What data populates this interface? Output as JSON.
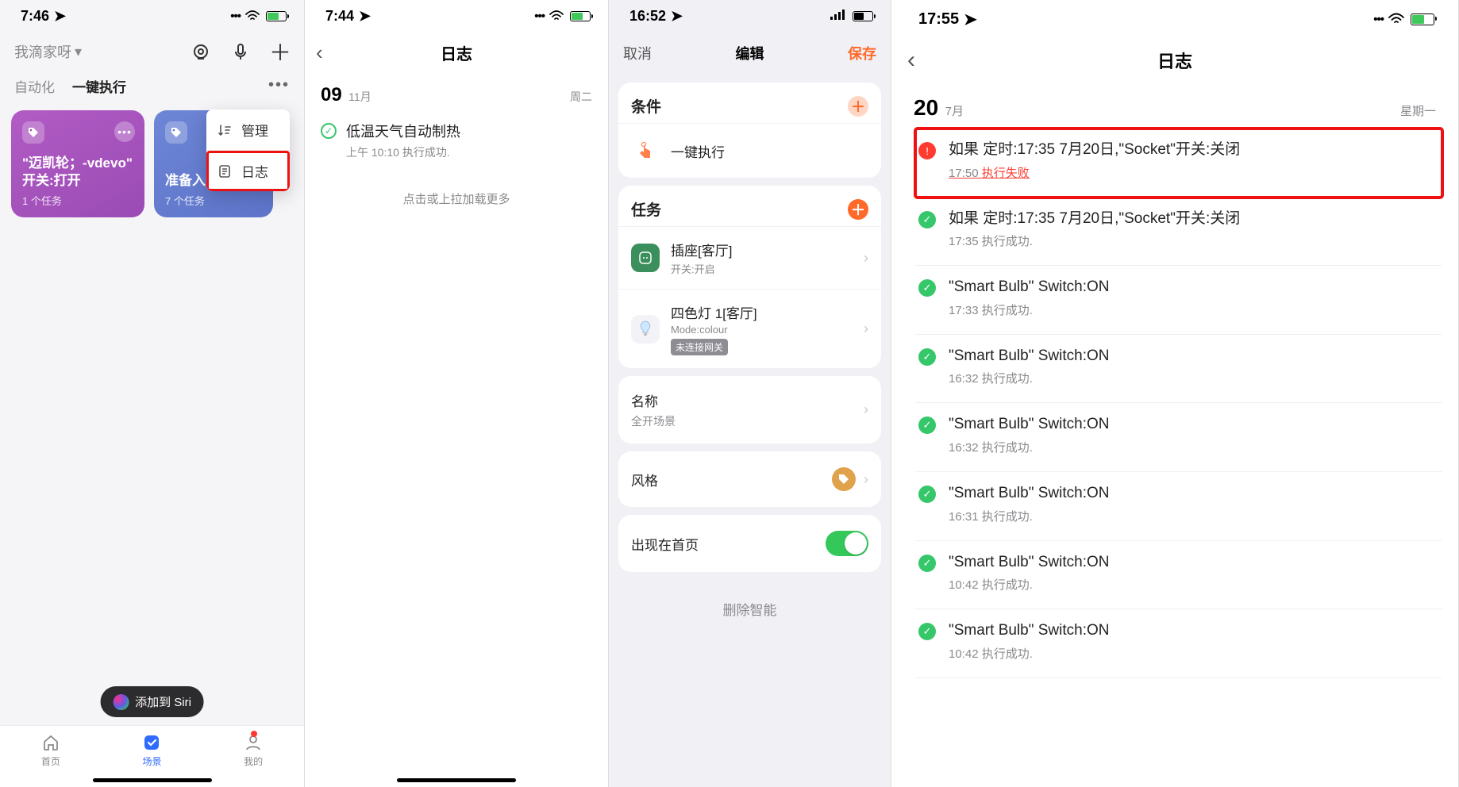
{
  "screen1": {
    "status": {
      "time": "7:46",
      "signal": "⠿",
      "wifi": "wifi",
      "batt_pct": 60
    },
    "home_select": "我滴家呀",
    "tabs": {
      "auto": "自动化",
      "scene": "一键执行"
    },
    "popover": {
      "manage": "管理",
      "log": "日志"
    },
    "cards": [
      {
        "title": "\"迈凯轮；-vdevo\"\n开关:打开",
        "sub": "1 个任务",
        "cls": "purple"
      },
      {
        "title": "准备入睡",
        "sub": "7 个任务",
        "cls": "blue"
      }
    ],
    "siri": "添加到 Siri",
    "tabbar": {
      "home": "首页",
      "scene": "场景",
      "me": "我的"
    }
  },
  "screen2": {
    "status": {
      "time": "7:44",
      "batt_pct": 60
    },
    "title": "日志",
    "date_day": "09",
    "date_month": "11月",
    "date_wd": "周二",
    "log_title": "低温天气自动制热",
    "log_sub": "上午 10:10 执行成功.",
    "hint": "点击或上拉加载更多"
  },
  "screen3": {
    "status": {
      "time": "16:52",
      "batt_pct": 50
    },
    "nav": {
      "cancel": "取消",
      "title": "编辑",
      "save": "保存"
    },
    "cond": {
      "header": "条件",
      "type": "一键执行"
    },
    "task": {
      "header": "任务",
      "items": [
        {
          "icon": "socket",
          "title": "插座[客厅]",
          "sub": "开关:开启"
        },
        {
          "icon": "bulb",
          "title": "四色灯 1[客厅]",
          "sub": "Mode:colour",
          "badge": "未连接网关"
        }
      ]
    },
    "name": {
      "label": "名称",
      "value": "全开场景"
    },
    "style": {
      "label": "风格"
    },
    "homepage": {
      "label": "出现在首页"
    },
    "delete": "删除智能"
  },
  "screen4": {
    "status": {
      "time": "17:55",
      "batt_pct": 55
    },
    "title": "日志",
    "date_day": "20",
    "date_month": "7月",
    "date_wd": "星期一",
    "rows": [
      {
        "status": "err",
        "title": "如果 定时:17:35 7月20日,\"Socket\"开关:关闭",
        "time": "17:50",
        "result": "执行失败",
        "highlight": true
      },
      {
        "status": "ok",
        "title": "如果 定时:17:35 7月20日,\"Socket\"开关:关闭",
        "time": "17:35",
        "result": "执行成功."
      },
      {
        "status": "ok",
        "title": "\"Smart Bulb\" Switch:ON",
        "time": "17:33",
        "result": "执行成功."
      },
      {
        "status": "ok",
        "title": "\"Smart Bulb\" Switch:ON",
        "time": "16:32",
        "result": "执行成功."
      },
      {
        "status": "ok",
        "title": "\"Smart Bulb\" Switch:ON",
        "time": "16:32",
        "result": "执行成功."
      },
      {
        "status": "ok",
        "title": "\"Smart Bulb\" Switch:ON",
        "time": "16:31",
        "result": "执行成功."
      },
      {
        "status": "ok",
        "title": "\"Smart Bulb\" Switch:ON",
        "time": "10:42",
        "result": "执行成功."
      },
      {
        "status": "ok",
        "title": "\"Smart Bulb\" Switch:ON",
        "time": "10:42",
        "result": "执行成功."
      }
    ]
  }
}
